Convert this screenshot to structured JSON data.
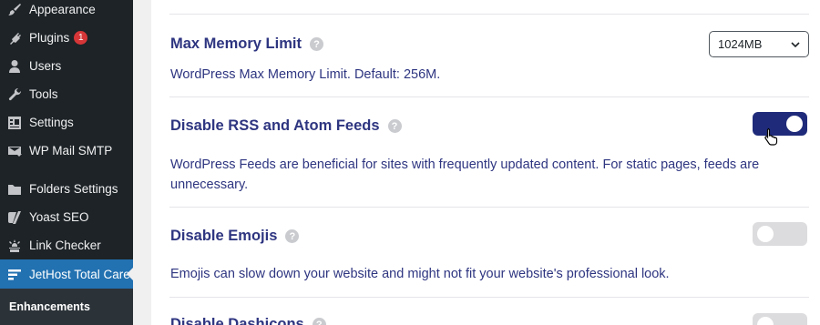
{
  "sidebar": {
    "items": [
      {
        "label": "Appearance",
        "icon": "paintbrush-icon"
      },
      {
        "label": "Plugins",
        "icon": "plugin-icon",
        "badge": "1"
      },
      {
        "label": "Users",
        "icon": "user-icon"
      },
      {
        "label": "Tools",
        "icon": "wrench-icon"
      },
      {
        "label": "Settings",
        "icon": "settings-icon"
      },
      {
        "label": "WP Mail SMTP",
        "icon": "mail-icon"
      },
      {
        "label": "Folders Settings",
        "icon": "folder-icon"
      },
      {
        "label": "Yoast SEO",
        "icon": "yoast-icon"
      },
      {
        "label": "Link Checker",
        "icon": "link-checker-icon"
      },
      {
        "label": "JetHost Total Care",
        "icon": "jethost-icon"
      }
    ],
    "submenu": {
      "label": "Enhancements"
    }
  },
  "settings": {
    "memory": {
      "title": "Max Memory Limit",
      "description": "WordPress Max Memory Limit. Default: 256M.",
      "selected": "1024MB"
    },
    "rss": {
      "title": "Disable RSS and Atom Feeds",
      "description": "WordPress Feeds are beneficial for sites with frequently updated content. For static pages, feeds are unnecessary.",
      "enabled": true
    },
    "emojis": {
      "title": "Disable Emojis",
      "description": "Emojis can slow down your website and might not fit your website's professional look.",
      "enabled": false
    },
    "dashicons": {
      "title": "Disable Dashicons",
      "enabled": false
    }
  },
  "colors": {
    "accent": "#2271b1",
    "toggle_on": "#1f2b7a",
    "title_text": "#2e3580",
    "badge": "#d63638"
  }
}
